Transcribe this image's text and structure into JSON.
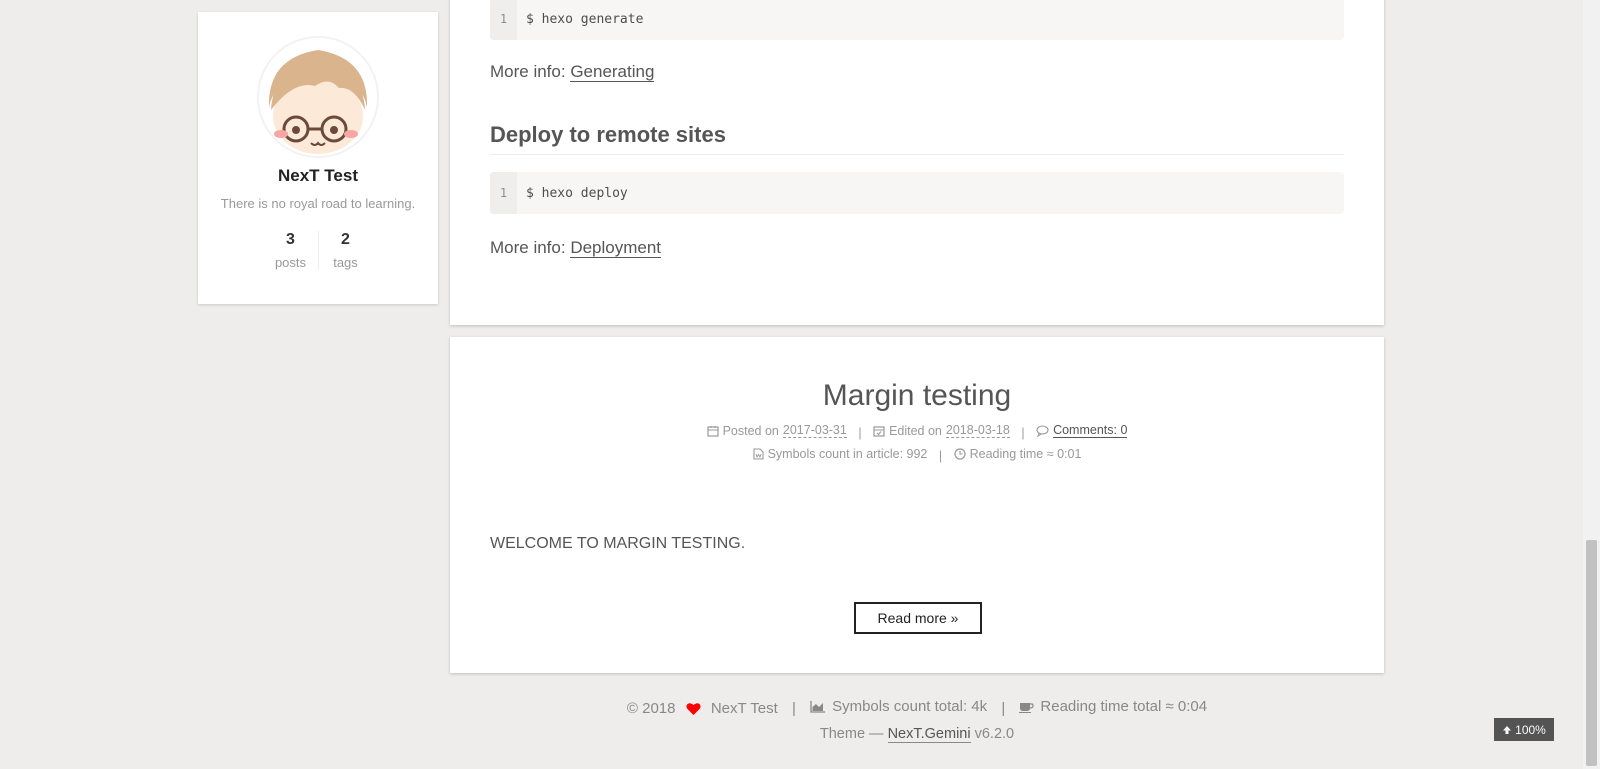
{
  "sidebar": {
    "author_name": "NexT Test",
    "motto": "There is no royal road to learning.",
    "stats": [
      {
        "count": "3",
        "label": "posts"
      },
      {
        "count": "2",
        "label": "tags"
      }
    ]
  },
  "post_prev": {
    "code_generate": {
      "line_no": "1",
      "code": "$ hexo generate"
    },
    "more_info_1": {
      "prefix": "More info: ",
      "link": "Generating"
    },
    "heading_deploy": "Deploy to remote sites",
    "code_deploy": {
      "line_no": "1",
      "code": "$ hexo deploy"
    },
    "more_info_2": {
      "prefix": "More info: ",
      "link": "Deployment"
    }
  },
  "post": {
    "title": "Margin testing",
    "posted_label": "Posted on",
    "posted_date": "2017-03-31",
    "edited_label": "Edited on",
    "edited_date": "2018-03-18",
    "comments": "Comments: 0",
    "symbols_count": "Symbols count in article: 992",
    "reading_time": "Reading time ≈ 0:01",
    "separator": "|",
    "excerpt": "WELCOME TO MARGIN TESTING.",
    "read_more": "Read more »"
  },
  "footer": {
    "copyright": "© 2018",
    "author": "NexT Test",
    "symbols_total": "Symbols count total: 4k",
    "reading_total": "Reading time total ≈ 0:04",
    "separator": "|",
    "theme_prefix": "Theme —",
    "theme_link": "NexT.Gemini",
    "theme_version": "v6.2.0"
  },
  "back_to_top": {
    "percent": "100%"
  },
  "colors": {
    "heart": "#ff0000",
    "background": "#eeedeb",
    "card": "#ffffff"
  }
}
